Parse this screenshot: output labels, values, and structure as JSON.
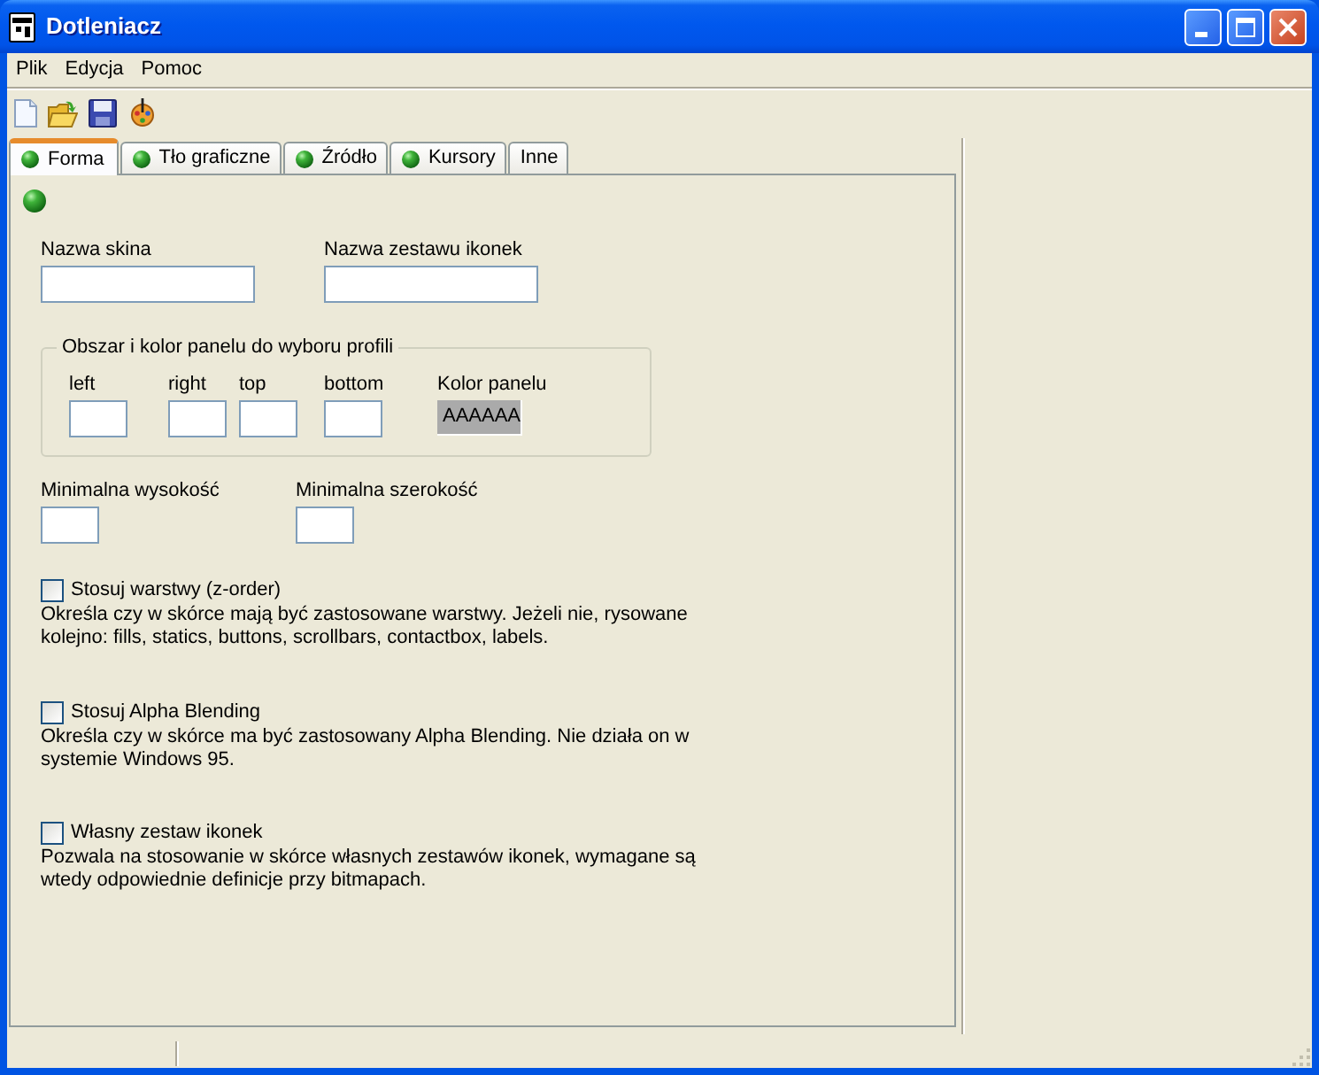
{
  "window": {
    "title": "Dotleniacz"
  },
  "menu": [
    "Plik",
    "Edycja",
    "Pomoc"
  ],
  "tabs": [
    {
      "label": "Forma",
      "selected": true,
      "kind": "icon"
    },
    {
      "label": "Tło graficzne",
      "selected": false,
      "kind": "icon"
    },
    {
      "label": "Źródło",
      "selected": false,
      "kind": "icon"
    },
    {
      "label": "Kursory",
      "selected": false,
      "kind": "icon"
    },
    {
      "label": "Inne",
      "selected": false,
      "kind": "text"
    }
  ],
  "names": [
    {
      "label": "Nazwa skina"
    },
    {
      "label": "Nazwa zestawu ikonek"
    }
  ],
  "panel_area": {
    "legend": "Obszar i kolor panelu do wyboru profili",
    "fields": [
      {
        "label": "left"
      },
      {
        "label": "right"
      },
      {
        "label": "top"
      },
      {
        "label": "bottom"
      }
    ],
    "color": {
      "label": "Kolor panelu",
      "value": "AAAAAA"
    }
  },
  "sizes": [
    {
      "label": "Minimalna wysokość"
    },
    {
      "label": "Minimalna szerokość"
    }
  ],
  "options": [
    {
      "label": "Stosuj warstwy (z-order)",
      "checked": false,
      "description": "Określa czy w skórce mają być zastosowane warstwy. Jeżeli nie, rysowane kolejno: fills, statics, buttons, scrollbars, contactbox, labels."
    },
    {
      "label": "Stosuj Alpha Blending",
      "checked": false,
      "description": "Określa czy w skórce ma być zastosowany Alpha Blending. Nie działa on w systemie Windows 95."
    },
    {
      "label": "Własny zestaw ikonek",
      "checked": false,
      "description": "Pozwala na stosowanie w skórce własnych zestawów ikonek, wymagane są wtedy odpowiednie definicje przy bitmapach."
    }
  ]
}
